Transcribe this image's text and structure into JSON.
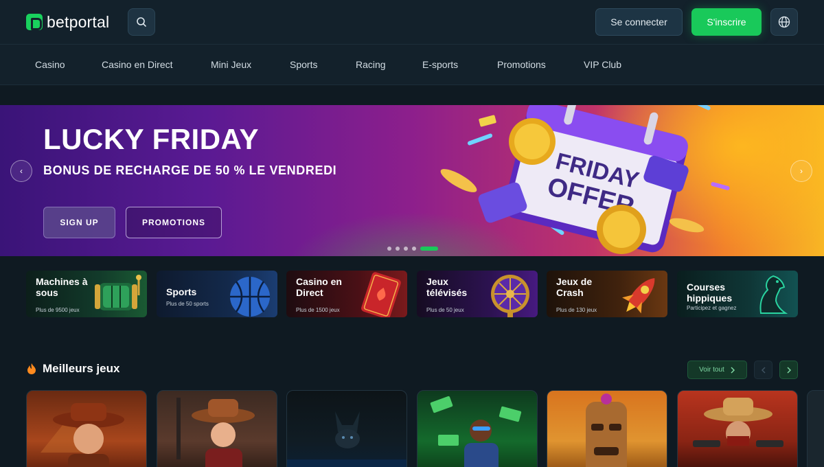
{
  "header": {
    "brand": "betportal",
    "login_label": "Se connecter",
    "signup_label": "S'inscrire",
    "icons": [
      "search-icon",
      "globe-icon"
    ]
  },
  "nav": {
    "items": [
      "Casino",
      "Casino en Direct",
      "Mini Jeux",
      "Sports",
      "Racing",
      "E-sports",
      "Promotions",
      "VIP Club"
    ]
  },
  "hero": {
    "title": "LUCKY FRIDAY",
    "subtitle": "BONUS DE RECHARGE DE 50 % LE VENDREDI",
    "primary_label": "SIGN UP",
    "secondary_label": "PROMOTIONS",
    "art_text": [
      "FRIDAY",
      "OFFER"
    ],
    "slide_count": 5,
    "active_slide": 5
  },
  "categories": [
    {
      "title": "Machines à sous",
      "subtitle": "Plus de 9500 jeux",
      "icon": "slot-reel-icon"
    },
    {
      "title": "Sports",
      "subtitle": "Plus de 50 sports",
      "icon": "basketball-icon"
    },
    {
      "title": "Casino en Direct",
      "subtitle": "Plus de 1500 jeux",
      "icon": "playing-card-icon"
    },
    {
      "title": "Jeux télévisés",
      "subtitle": "Plus de 50 jeux",
      "icon": "prize-wheel-icon"
    },
    {
      "title": "Jeux de Crash",
      "subtitle": "Plus de 130 jeux",
      "icon": "rocket-icon"
    },
    {
      "title": "Courses hippiques",
      "subtitle": "Participez et gagnez",
      "icon": "horse-icon"
    }
  ],
  "best_games": {
    "title": "Meilleurs jeux",
    "see_all_label": "Voir tout",
    "icon": "flame-icon"
  },
  "colors": {
    "accent_green": "#19c95a",
    "page_bg": "#0f1a22",
    "header_bg": "#13212b"
  }
}
